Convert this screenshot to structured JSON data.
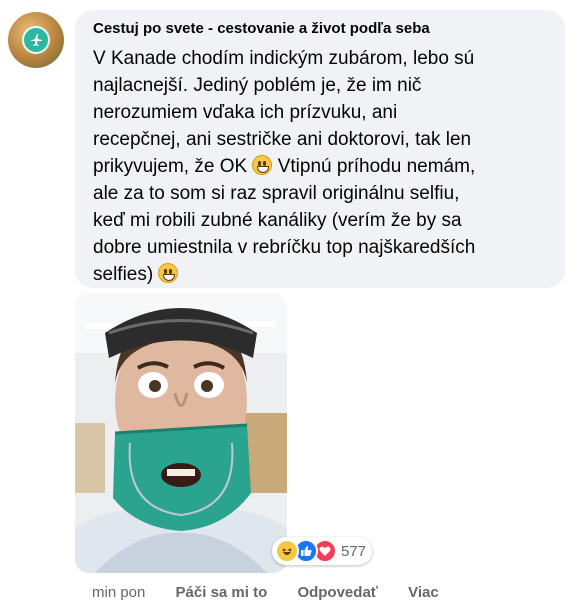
{
  "comment": {
    "author": "Cestuj po svete - cestovanie a život podľa seba",
    "text_lines": [
      "V Kanade chodím indickým zubárom, lebo sú",
      "najlacnejší. Jediný poblém je, že im nič",
      "nerozumiem vďaka ich prízvuku, ani",
      "recepčnej, ani sestričke ani doktorovi, tak len",
      "prikyvujem, že OK",
      "Vtipnú príhodu nemám,",
      "ale za to som si raz spravil originálnu selfiu,",
      "keď mi robili zubné kanáliky (verím že by sa",
      "dobre umiestnila v rebríčku top najškaredších",
      "selfies)"
    ],
    "emoji": "grinning-face-emoji"
  },
  "reactions": {
    "icons": [
      "haha-reaction-icon",
      "like-reaction-icon",
      "love-reaction-icon"
    ],
    "count": "577"
  },
  "actions": {
    "time": "min pon",
    "like": "Páči sa mi to",
    "reply": "Odpovedať",
    "more": "Viac"
  },
  "colors": {
    "bubble": "#f0f2f5",
    "text": "#050505",
    "muted": "#65676b",
    "like": "#1877f2",
    "love": "#f33e58",
    "haha": "#f7c744"
  }
}
